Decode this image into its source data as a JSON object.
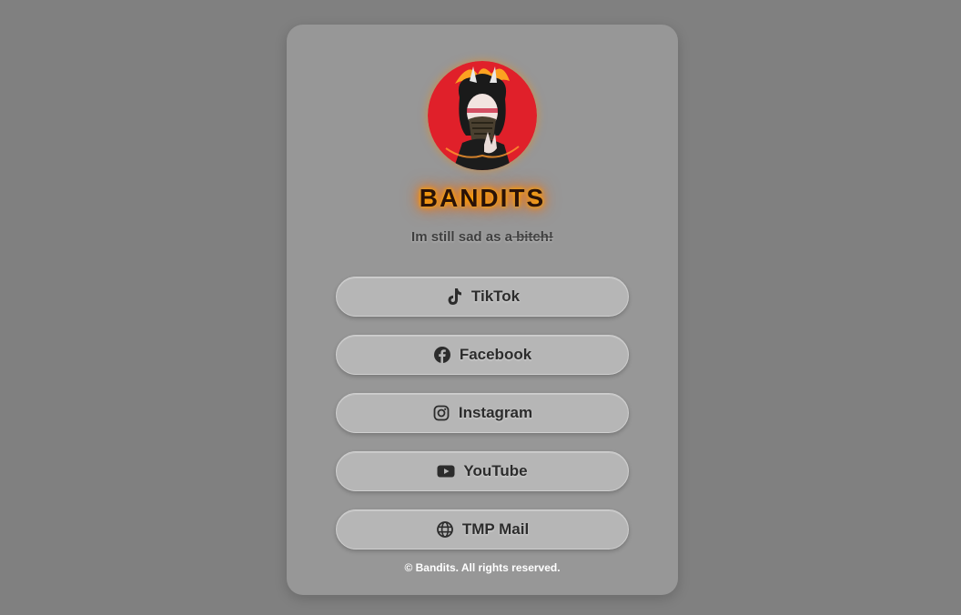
{
  "profile": {
    "name": "BANDITS",
    "tagline_prefix": "Im still sad as a",
    "tagline_struck": " bitch!",
    "avatar_icon": "masked-oni-girl-avatar"
  },
  "links": [
    {
      "label": "TikTok",
      "icon": "tiktok-icon"
    },
    {
      "label": "Facebook",
      "icon": "facebook-icon"
    },
    {
      "label": "Instagram",
      "icon": "instagram-icon"
    },
    {
      "label": "YouTube",
      "icon": "youtube-icon"
    },
    {
      "label": "TMP Mail",
      "icon": "globe-icon"
    }
  ],
  "footer": {
    "text": "© Bandits. All rights reserved."
  },
  "colors": {
    "page_background": "#808080",
    "card_background": "#979797",
    "button_background": "#b6b6b6",
    "brand_glow": "#ff8c00",
    "avatar_red": "#e0202a"
  }
}
